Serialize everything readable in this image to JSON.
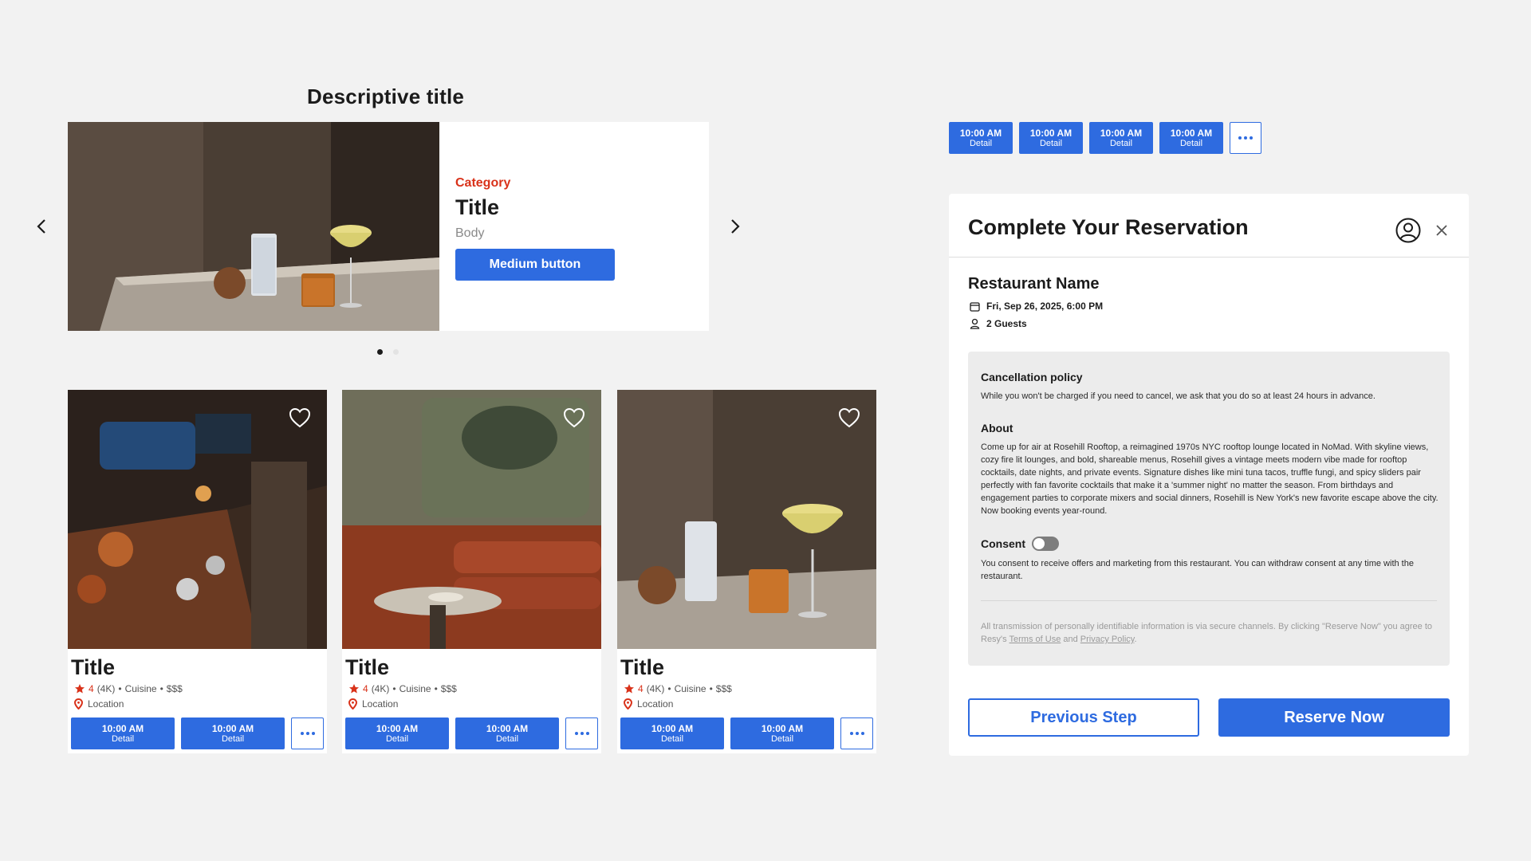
{
  "hero": {
    "section_title": "Descriptive title",
    "category": "Category",
    "title": "Title",
    "body": "Body",
    "button_label": "Medium button"
  },
  "cards": [
    {
      "title": "Title",
      "rating": "4",
      "reviews": "(4K)",
      "cuisine": "Cuisine",
      "price": "$$$",
      "location": "Location",
      "slots": [
        {
          "time": "10:00 AM",
          "detail": "Detail"
        },
        {
          "time": "10:00 AM",
          "detail": "Detail"
        }
      ]
    },
    {
      "title": "Title",
      "rating": "4",
      "reviews": "(4K)",
      "cuisine": "Cuisine",
      "price": "$$$",
      "location": "Location",
      "slots": [
        {
          "time": "10:00 AM",
          "detail": "Detail"
        },
        {
          "time": "10:00 AM",
          "detail": "Detail"
        }
      ]
    },
    {
      "title": "Title",
      "rating": "4",
      "reviews": "(4K)",
      "cuisine": "Cuisine",
      "price": "$$$",
      "location": "Location",
      "slots": [
        {
          "time": "10:00 AM",
          "detail": "Detail"
        },
        {
          "time": "10:00 AM",
          "detail": "Detail"
        }
      ]
    }
  ],
  "top_slots": [
    {
      "time": "10:00 AM",
      "detail": "Detail"
    },
    {
      "time": "10:00 AM",
      "detail": "Detail"
    },
    {
      "time": "10:00 AM",
      "detail": "Detail"
    },
    {
      "time": "10:00 AM",
      "detail": "Detail"
    }
  ],
  "reservation": {
    "title": "Complete Your Reservation",
    "restaurant_name": "Restaurant Name",
    "datetime": "Fri, Sep 26, 2025, 6:00 PM",
    "guests": "2 Guests",
    "cancellation_heading": "Cancellation policy",
    "cancellation_text": "While you won't be charged if you need to cancel, we ask that you do so at least 24 hours in advance.",
    "about_heading": "About",
    "about_text": "Come up for air at Rosehill Rooftop, a reimagined 1970s NYC rooftop lounge located in NoMad. With skyline views, cozy fire lit lounges, and bold, shareable menus, Rosehill gives a vintage meets modern vibe made for rooftop cocktails, date nights, and private events. Signature dishes like mini tuna tacos, truffle fungi, and spicy sliders pair perfectly with fan favorite cocktails that make it a 'summer night' no matter the season. From birthdays and engagement parties to corporate mixers and social dinners, Rosehill is New York's new favorite escape above the city. Now booking events year-round.",
    "consent_heading": "Consent",
    "consent_on": false,
    "consent_text": "You consent to receive offers and marketing from this restaurant. You can withdraw consent at any time with the restaurant.",
    "fine_print_1": "All transmission of personally identifiable information is via secure channels. By clicking \"Reserve Now\" you agree to Resy's ",
    "terms_link": "Terms of Use",
    "fine_print_and": " and ",
    "privacy_link": "Privacy Policy",
    "fine_print_end": ".",
    "prev_button": "Previous Step",
    "reserve_button": "Reserve Now"
  },
  "colors": {
    "accent": "#2e6be0",
    "category": "#d9321a",
    "background": "#f2f2f2"
  }
}
